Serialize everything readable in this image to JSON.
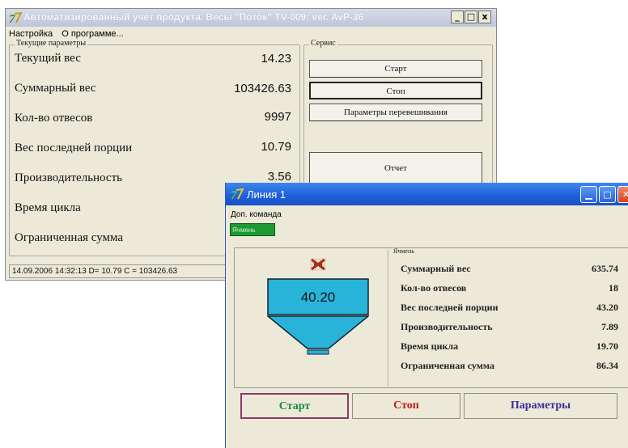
{
  "main_window": {
    "title": "Автоматизированный учет продукта.  Весы \"Поток\"  TV-009; ver. AvP-36",
    "controls": {
      "minimize": "_",
      "maximize": "□",
      "close": "x"
    },
    "menu": [
      "Настройка",
      "О программе..."
    ],
    "params_legend": "Текущие параметры",
    "params": [
      {
        "label": "Текущий вес",
        "value": "14.23"
      },
      {
        "label": "Суммарный вес",
        "value": "103426.63"
      },
      {
        "label": "Кол-во отвесов",
        "value": "9997"
      },
      {
        "label": "Вес последней порции",
        "value": "10.79"
      },
      {
        "label": "Производительность",
        "value": "3.56"
      },
      {
        "label": "Время цикла",
        "value": ""
      },
      {
        "label": "Ограниченная сумма",
        "value": ""
      }
    ],
    "service_legend": "Сервис",
    "service_buttons": [
      "Старт",
      "Стоп",
      "Параметры перевешивания",
      "Отчет"
    ],
    "status": "14.09.2006 14:32:13  D= 10.79  C = 103426.63"
  },
  "line_window": {
    "title": "Линия 1",
    "menu": "Доп. команда",
    "tab": "Ячмень",
    "panel_legend": "Ячмень",
    "hopper_value": "40.20",
    "hopper_color": "#28b4d8",
    "stats": [
      {
        "label": "Суммарный вес",
        "value": "635.74"
      },
      {
        "label": "Кол-во отвесов",
        "value": "18"
      },
      {
        "label": "Вес последней порции",
        "value": "43.20"
      },
      {
        "label": "Производительность",
        "value": "7.89"
      },
      {
        "label": "Время цикла",
        "value": "19.70"
      },
      {
        "label": "Ограниченная сумма",
        "value": "86.34"
      }
    ],
    "buttons": [
      {
        "label": "Старт",
        "color": "#1a8a3a"
      },
      {
        "label": "Стоп",
        "color": "#c01818"
      },
      {
        "label": "Параметры",
        "color": "#3a2e9a"
      }
    ]
  }
}
